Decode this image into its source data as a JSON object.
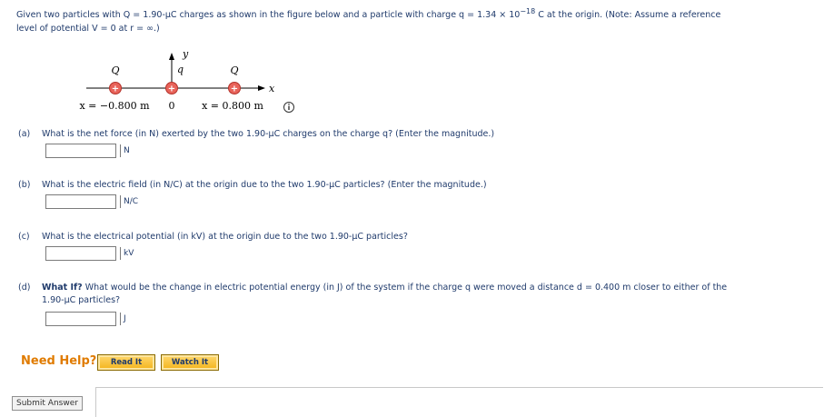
{
  "intro": {
    "line1_a": "Given two particles with Q = 1.90-μC charges as shown in the figure below and a particle with charge q = 1.34 × 10",
    "line1_exp": "−18",
    "line1_b": " C at the origin. (Note: Assume a reference",
    "line2": "level of potential V = 0 at r = ∞.)"
  },
  "figure": {
    "y_axis_label": "y",
    "x_axis_label": "x",
    "left_charge_label": "Q",
    "center_charge_label": "q",
    "right_charge_label": "Q",
    "plus_sign": "+",
    "left_position": "x = −0.800 m",
    "origin_label": "0",
    "right_position": "x = 0.800 m",
    "info_icon": "info-circle-icon"
  },
  "parts": [
    {
      "letter": "(a)",
      "question": "What is the net force (in N) exerted by the two 1.90-μC charges on the charge q? (Enter the magnitude.)",
      "value": "",
      "unit": "N"
    },
    {
      "letter": "(b)",
      "question": "What is the electric field (in N/C) at the origin due to the two 1.90-μC particles? (Enter the magnitude.)",
      "value": "",
      "unit": "N/C"
    },
    {
      "letter": "(c)",
      "question": "What is the electrical potential (in kV) at the origin due to the two 1.90-μC particles?",
      "value": "",
      "unit": "kV"
    },
    {
      "letter": "(d)",
      "whatif": "What If?",
      "question_line1": " What would be the change in electric potential energy (in J) of the system if the charge q were moved a distance d = 0.400 m closer to either of the",
      "question_line2": "1.90-μC particles?",
      "value": "",
      "unit": "J"
    }
  ],
  "help": {
    "label": "Need Help?",
    "read_it": "Read It",
    "watch_it": "Watch It"
  },
  "submit_label": "Submit Answer"
}
